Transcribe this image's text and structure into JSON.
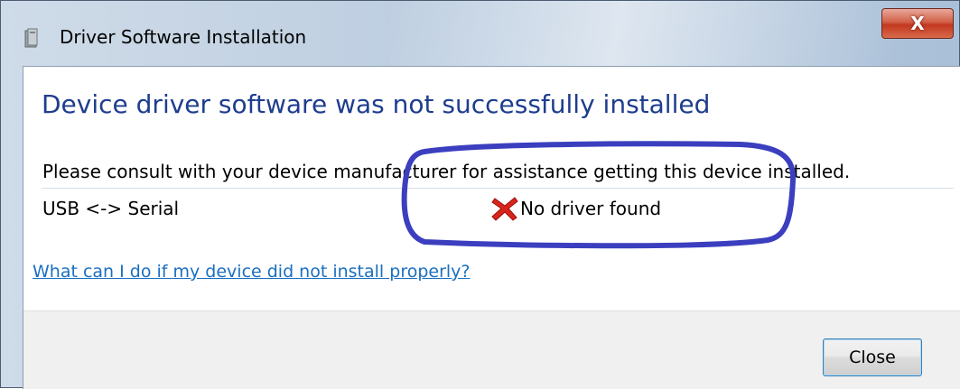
{
  "window": {
    "title": "Driver Software Installation",
    "close_glyph": "X",
    "app_icon": "installer-icon"
  },
  "content": {
    "heading": "Device driver software was not successfully installed",
    "message": "Please consult with your device manufacturer for assistance getting this device installed.",
    "devices": [
      {
        "name": "USB <-> Serial",
        "status": "No driver found",
        "status_icon": "error-x-icon"
      }
    ],
    "help_link": "What can I do if my device did not install properly?"
  },
  "footer": {
    "close_label": "Close"
  },
  "colors": {
    "heading": "#1e3d8f",
    "link": "#1a6fc1",
    "annotation": "#3b3fbf",
    "error": "#d9241c"
  }
}
